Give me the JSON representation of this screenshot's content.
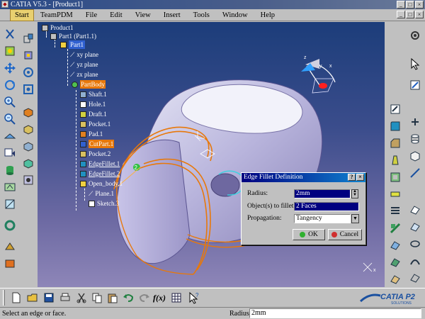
{
  "window": {
    "title": "CATIA V5.3 - [Product1]"
  },
  "menu": [
    "Start",
    "TeamPDM",
    "File",
    "Edit",
    "View",
    "Insert",
    "Tools",
    "Window",
    "Help"
  ],
  "tree": {
    "product": "Product1",
    "part": "Part1 (Part1.1)",
    "part_sel": "Part1",
    "planes": [
      "xy plane",
      "yz plane",
      "zx plane"
    ],
    "partbody": "PartBody",
    "features": [
      "Shaft.1",
      "Hole.1",
      "Draft.1",
      "Pocket.1",
      "Pad.1",
      "CutPart.1",
      "Pocket.2",
      "EdgeFillet.1",
      "EdgeFillet.2"
    ],
    "open_body": "Open_body.1",
    "open_children": [
      "Plane.1",
      "Sketch.3"
    ]
  },
  "dialog": {
    "title": "Edge Fillet Definition",
    "help": "?",
    "close": "×",
    "radius_label": "Radius:",
    "radius_value": "2mm",
    "objects_label": "Object(s) to fillet:",
    "objects_value": "2 Faces",
    "propagation_label": "Propagation:",
    "propagation_value": "Tangency",
    "ok": "OK",
    "cancel": "Cancel"
  },
  "viewport": {
    "edge_marker": "2"
  },
  "branding": {
    "logo": "CATIA P2",
    "tagline": "SOLUTIONS"
  },
  "status": {
    "message": "Select an edge or face.",
    "field_label": "Radius",
    "field_value": "2mm"
  },
  "colors": {
    "highlight": "#e8780a",
    "selection": "#3060d0",
    "titlebar": "#000080"
  }
}
